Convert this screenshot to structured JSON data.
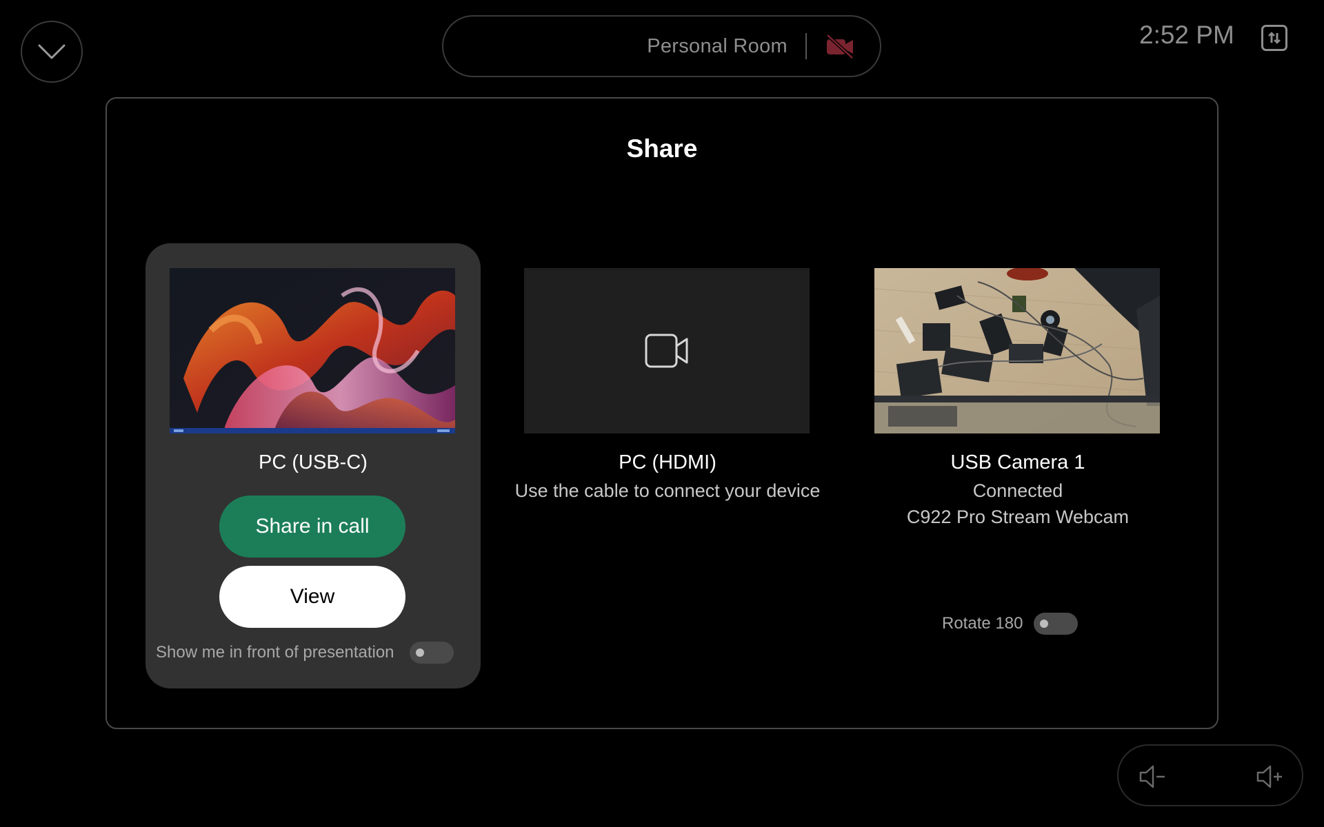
{
  "top_bar": {
    "room_name": "Personal Room",
    "time": "2:52 PM"
  },
  "share": {
    "title": "Share",
    "sources": [
      {
        "name": "PC (USB-C)",
        "share_label": "Share in call",
        "view_label": "View",
        "toggle_label": "Show me in front of presentation",
        "toggle_on": false
      },
      {
        "name": "PC (HDMI)",
        "subtitle": "Use the cable to connect your device"
      },
      {
        "name": "USB Camera 1",
        "status": "Connected",
        "device": "C922 Pro Stream Webcam",
        "toggle_label": "Rotate 180",
        "toggle_on": false
      }
    ]
  },
  "colors": {
    "accent_green": "#1c7e58",
    "camera_muted_red": "#7a2430"
  }
}
